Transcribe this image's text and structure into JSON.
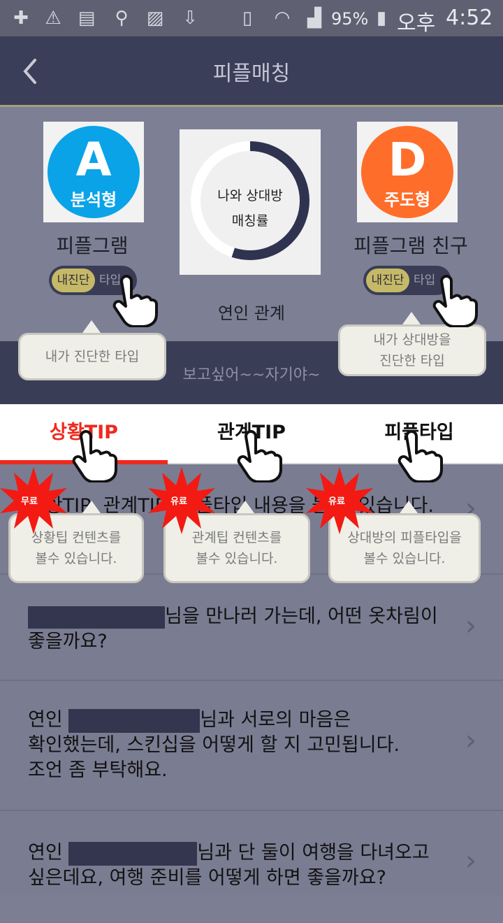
{
  "status_bar": {
    "battery_percent": "95%",
    "ampm": "오후",
    "time": "4:52"
  },
  "header": {
    "title": "피플매칭",
    "back_icon": "chevron-left-icon"
  },
  "profiles": {
    "mine": {
      "letter": "A",
      "type_label": "분석형",
      "name": "피플그램",
      "color": "#0aa3e8",
      "toggle_on": "내진단",
      "toggle_off": "타입"
    },
    "friend": {
      "letter": "D",
      "type_label": "주도형",
      "name": "피플그램 친구",
      "color": "#ff6d2a",
      "toggle_on": "내진단",
      "toggle_off": "타입"
    }
  },
  "match": {
    "line1": "나와 상대방",
    "line2": "매칭률",
    "relationship": "연인 관계",
    "progress": 0.55
  },
  "status_message": "보고싶어~~자기야~",
  "tabs": [
    {
      "label": "상황TIP",
      "active": true
    },
    {
      "label": "관계TIP",
      "active": false
    },
    {
      "label": "피플타입",
      "active": false
    }
  ],
  "list_items": [
    {
      "text": "상황TIP, 관계TIP, 피플타입 내용을 볼 수 있습니다."
    },
    {
      "line1_suffix": "님을 만나러 가는데, 어떤 옷차림이",
      "line2": "좋을까요?"
    },
    {
      "line1_prefix": "연인",
      "line1_suffix": "님과 서로의 마음은",
      "line2": "확인했는데, 스킨십을 어떻게 할 지 고민됩니다.",
      "line3": "조언 좀 부탁해요."
    },
    {
      "line1_prefix": "연인",
      "line1_suffix": "님과 단 둘이 여행을 다녀오고",
      "line2": "싶은데요, 여행 준비를 어떻게 하면 좋을까요?"
    }
  ],
  "tooltips": {
    "my_type": "내가 진단한 타입",
    "partner_type_line1": "내가 상대방을",
    "partner_type_line2": "진단한 타입",
    "tip1_line1": "상황팁 컨텐츠를",
    "tip1_line2": "볼수 있습니다.",
    "tip2_line1": "관계팁 컨텐츠를",
    "tip2_line2": "볼수 있습니다.",
    "tip3_line1": "상대방의 피플타입을",
    "tip3_line2": "볼수 있습니다."
  },
  "badges": {
    "free": "무료",
    "paid1": "유료",
    "paid2": "유료"
  },
  "colors": {
    "accent_red": "#ee2a1e",
    "header_bg": "#3b3e58",
    "toggle_active": "#c5b968"
  }
}
